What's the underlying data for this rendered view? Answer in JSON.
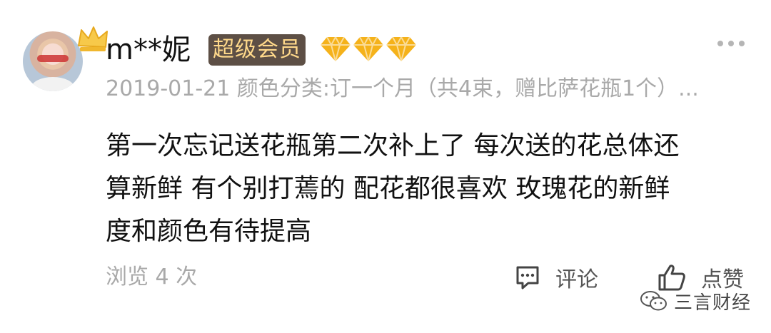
{
  "review": {
    "username": "m**妮",
    "member_badge": "超级会员",
    "gem_count": 3,
    "date": "2019-01-21",
    "meta": "颜色分类:订一个月（共4束，赠比萨花瓶1个）...",
    "content_lines": [
      "第一次忘记送花瓶第二次补上了 每次送的花总体还",
      "算新鲜 有个别打蔫的 配花都很喜欢 玫瑰花的新鲜",
      "度和颜色有待提高"
    ],
    "views": "浏览 4 次",
    "comment_label": "评论",
    "like_label": "点赞"
  },
  "watermark": {
    "text": "三言财经"
  },
  "colors": {
    "badge_bg": "#5d4f45",
    "badge_text": "#ffd98b",
    "gem": "#f5b21a",
    "meta_text": "#a9a9a9"
  },
  "icons": [
    "crown-icon",
    "gem-icon",
    "more-icon",
    "comment-icon",
    "thumbs-up-icon",
    "wechat-icon"
  ]
}
